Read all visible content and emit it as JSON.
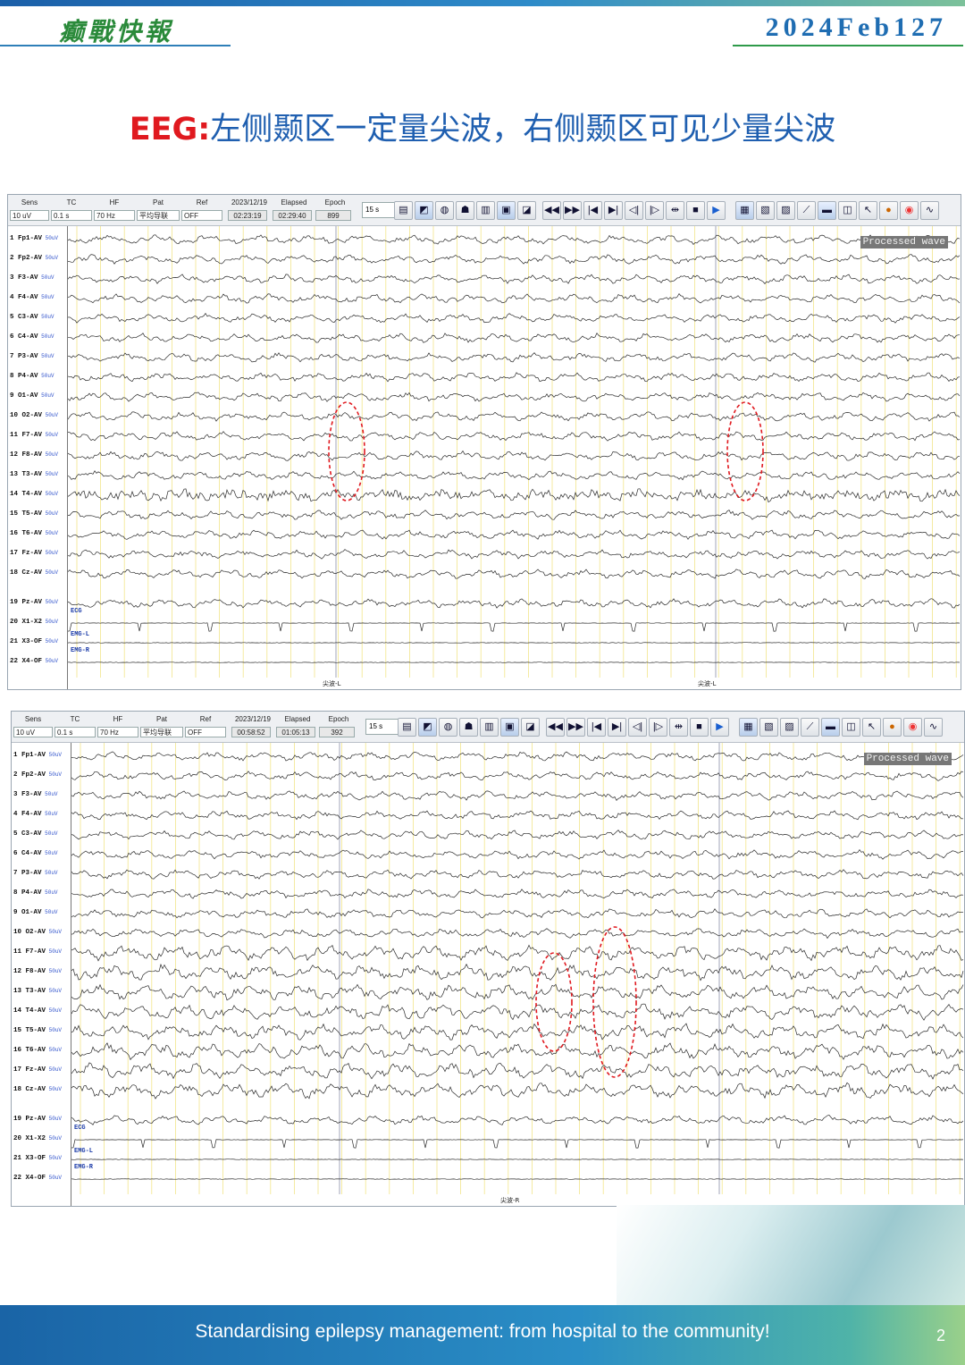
{
  "header": {
    "brand": "癫戰快報",
    "issue": "2024Feb127"
  },
  "headline": {
    "lead": "EEG:",
    "rest": "左侧颞区一定量尖波，右侧颞区可见少量尖波"
  },
  "toolbar_labels": {
    "sens": "Sens",
    "tc": "TC",
    "hf": "HF",
    "pat": "Pat",
    "ref": "Ref",
    "elapsed": "Elapsed",
    "epoch": "Epoch"
  },
  "panel1": {
    "values": {
      "sens": "10 uV",
      "tc": "0.1 s",
      "hf": "70 Hz",
      "pat": "平均导联",
      "ref": "OFF"
    },
    "date": "2023/12/19",
    "time": "02:23:19",
    "elapsed": "02:29:40",
    "epoch": "899",
    "page_len": "15 s",
    "processed_label": "Processed wave",
    "markers": [
      "尖波-L",
      "尖波-L"
    ]
  },
  "panel2": {
    "values": {
      "sens": "10 uV",
      "tc": "0.1 s",
      "hf": "70 Hz",
      "pat": "平均导联",
      "ref": "OFF"
    },
    "date": "2023/12/19",
    "time": "00:58:52",
    "elapsed": "01:05:13",
    "epoch": "392",
    "page_len": "15 s",
    "processed_label": "Processed wave",
    "markers": [
      "尖波-R"
    ]
  },
  "channels": [
    {
      "n": "1",
      "name": "Fp1-AV"
    },
    {
      "n": "2",
      "name": "Fp2-AV"
    },
    {
      "n": "3",
      "name": "F3-AV"
    },
    {
      "n": "4",
      "name": "F4-AV"
    },
    {
      "n": "5",
      "name": "C3-AV"
    },
    {
      "n": "6",
      "name": "C4-AV"
    },
    {
      "n": "7",
      "name": "P3-AV"
    },
    {
      "n": "8",
      "name": "P4-AV"
    },
    {
      "n": "9",
      "name": "O1-AV"
    },
    {
      "n": "10",
      "name": "O2-AV"
    },
    {
      "n": "11",
      "name": "F7-AV"
    },
    {
      "n": "12",
      "name": "F8-AV"
    },
    {
      "n": "13",
      "name": "T3-AV"
    },
    {
      "n": "14",
      "name": "T4-AV"
    },
    {
      "n": "15",
      "name": "T5-AV"
    },
    {
      "n": "16",
      "name": "T6-AV"
    },
    {
      "n": "17",
      "name": "Fz-AV"
    },
    {
      "n": "18",
      "name": "Cz-AV"
    },
    {
      "n": "19",
      "name": "Pz-AV"
    },
    {
      "n": "20",
      "name": "X1-X2"
    },
    {
      "n": "21",
      "name": "X3-OF"
    },
    {
      "n": "22",
      "name": "X4-OF"
    }
  ],
  "scale_label": "50uV",
  "aux_labels": {
    "ecg": "ECG",
    "emg_l": "EMG-L",
    "emg_r": "EMG-R"
  },
  "footer": {
    "text": "Standardising epilepsy management: from hospital to the community!",
    "page": "2"
  }
}
